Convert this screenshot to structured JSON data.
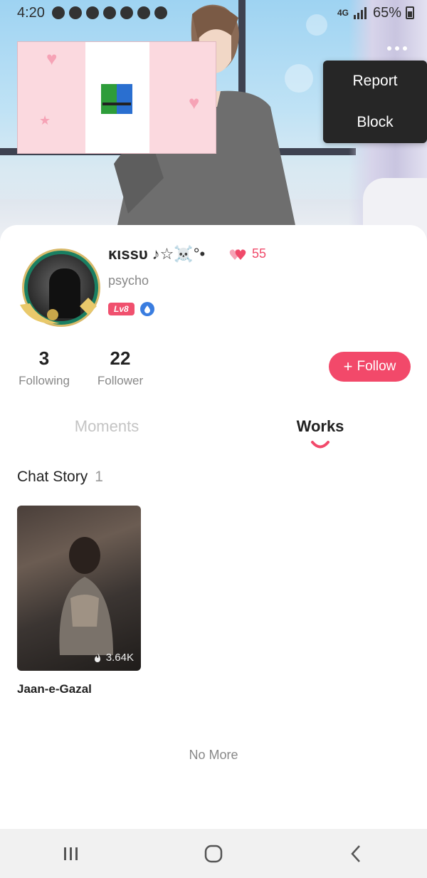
{
  "status_bar": {
    "time": "4:20",
    "network": "4G",
    "battery": "65%"
  },
  "menu": {
    "items": [
      "Report",
      "Block"
    ]
  },
  "profile": {
    "username": "ĸιѕѕυ",
    "name_decoration": "♪☆☠️°•",
    "likes_count": "55",
    "bio": "psycho",
    "level_badge": "Lv8"
  },
  "stats": {
    "following": {
      "value": "3",
      "label": "Following"
    },
    "follower": {
      "value": "22",
      "label": "Follower"
    }
  },
  "follow_button": {
    "label": "Follow"
  },
  "tabs": [
    {
      "label": "Moments",
      "active": false
    },
    {
      "label": "Works",
      "active": true
    }
  ],
  "section": {
    "title": "Chat Story",
    "count": "1"
  },
  "stories": [
    {
      "title": "Jaan-e-Gazal",
      "views": "3.64K"
    }
  ],
  "footer": {
    "no_more": "No More"
  },
  "colors": {
    "accent": "#f2496a",
    "menu_bg": "#262626"
  }
}
